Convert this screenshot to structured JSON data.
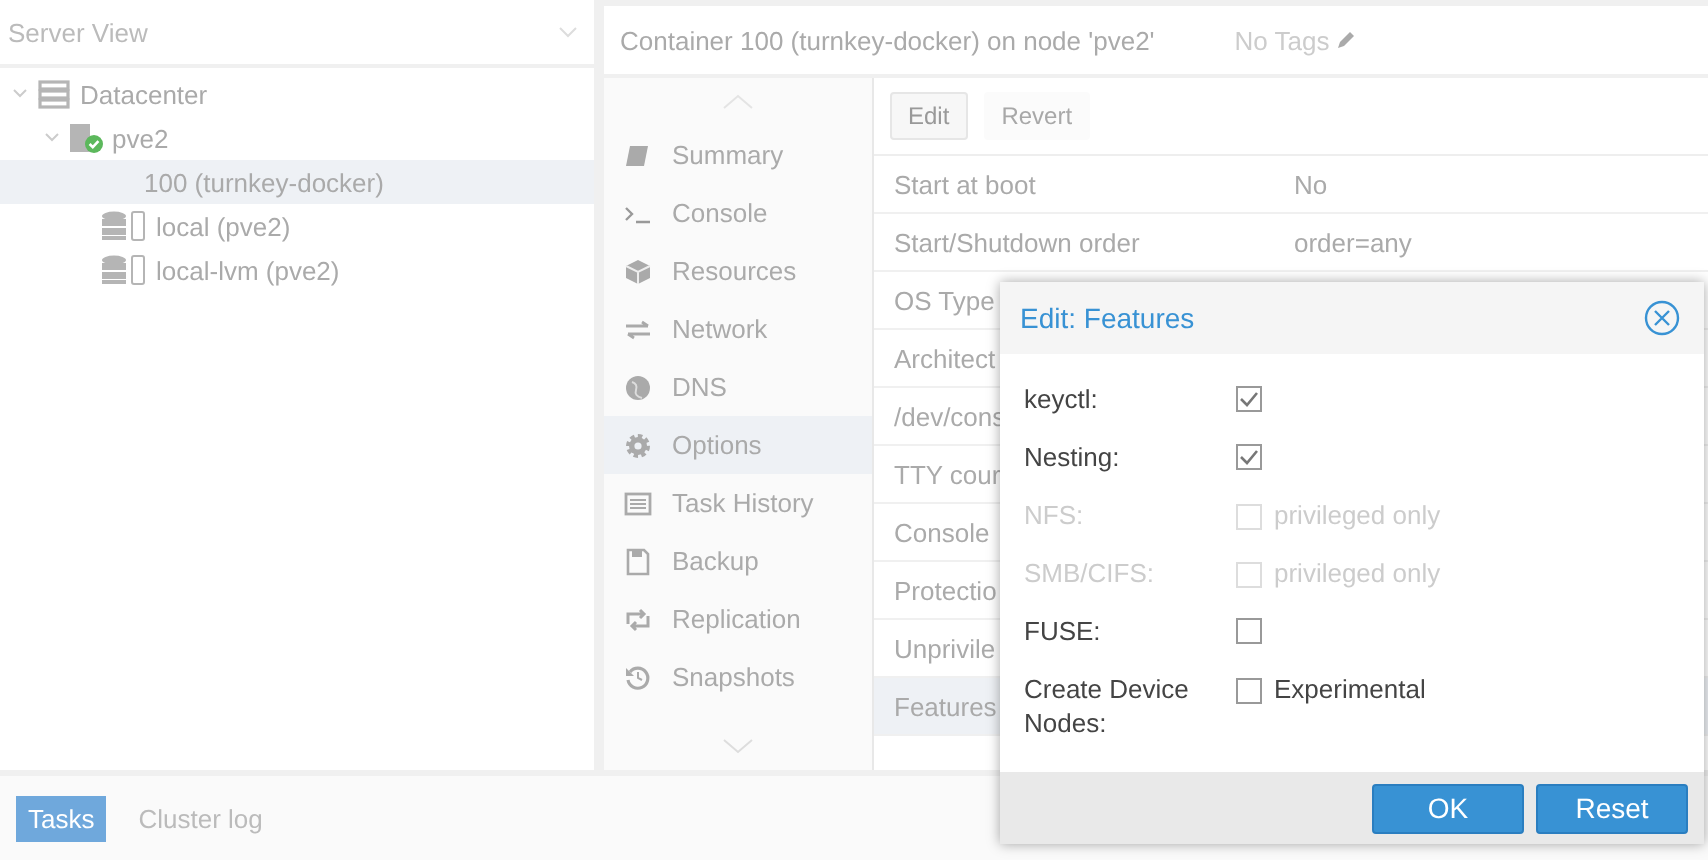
{
  "server_view": {
    "label": "Server View"
  },
  "tree": [
    {
      "label": "Datacenter",
      "kind": "datacenter",
      "expanded": true,
      "selected": false,
      "children": [
        {
          "label": "pve2",
          "kind": "node",
          "expanded": true,
          "selected": false,
          "children": [
            {
              "label": "100 (turnkey-docker)",
              "kind": "container",
              "selected": true
            },
            {
              "label": "local (pve2)",
              "kind": "storage",
              "selected": false
            },
            {
              "label": "local-lvm (pve2)",
              "kind": "storage",
              "selected": false
            }
          ]
        }
      ]
    }
  ],
  "header": {
    "title": "Container 100 (turnkey-docker) on node 'pve2'",
    "tags": "No Tags"
  },
  "nav": [
    {
      "label": "Summary",
      "selected": false
    },
    {
      "label": "Console",
      "selected": false
    },
    {
      "label": "Resources",
      "selected": false
    },
    {
      "label": "Network",
      "selected": false
    },
    {
      "label": "DNS",
      "selected": false
    },
    {
      "label": "Options",
      "selected": true
    },
    {
      "label": "Task History",
      "selected": false
    },
    {
      "label": "Backup",
      "selected": false
    },
    {
      "label": "Replication",
      "selected": false
    },
    {
      "label": "Snapshots",
      "selected": false
    }
  ],
  "toolbar": [
    {
      "label": "Edit",
      "disabled": false
    },
    {
      "label": "Revert",
      "disabled": true
    }
  ],
  "options": [
    {
      "name": "Start at boot",
      "value": "No",
      "selected": false
    },
    {
      "name": "Start/Shutdown order",
      "value": "order=any",
      "selected": false
    },
    {
      "name": "OS Type",
      "selected": false
    },
    {
      "name": "Architect",
      "selected": false
    },
    {
      "name": "/dev/cons",
      "selected": false
    },
    {
      "name": "TTY cour",
      "selected": false
    },
    {
      "name": "Console",
      "selected": false
    },
    {
      "name": "Protectio",
      "selected": false
    },
    {
      "name": "Unprivile",
      "selected": false
    },
    {
      "name": "Features",
      "selected": true
    }
  ],
  "dialog": {
    "title": "Edit: Features",
    "fields": [
      {
        "label": "keyctl:",
        "checked": true,
        "disabled": false
      },
      {
        "label": "Nesting:",
        "checked": true,
        "disabled": false
      },
      {
        "label": "NFS:",
        "checked": false,
        "disabled": true,
        "box_label": "privileged only"
      },
      {
        "label": "SMB/CIFS:",
        "checked": false,
        "disabled": true,
        "box_label": "privileged only"
      },
      {
        "label": "FUSE:",
        "checked": false,
        "disabled": false
      },
      {
        "label": "Create Device Nodes:",
        "checked": false,
        "disabled": false,
        "box_label": "Experimental"
      }
    ],
    "buttons": [
      "OK",
      "Reset"
    ]
  },
  "bottom_tabs": [
    {
      "label": "Tasks",
      "selected": true
    },
    {
      "label": "Cluster log",
      "selected": false
    }
  ]
}
